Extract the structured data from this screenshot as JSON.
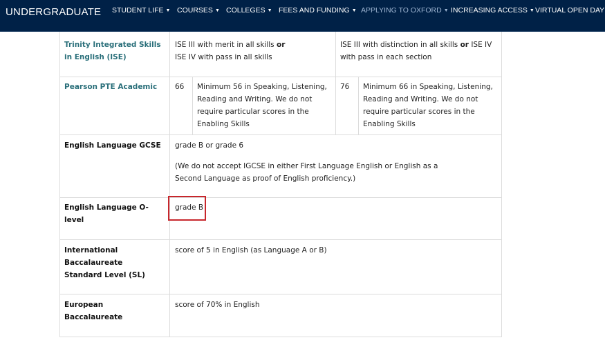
{
  "nav": {
    "brand": "UNDERGRADUATE",
    "items": [
      {
        "label": "STUDENT LIFE",
        "caret": "▼"
      },
      {
        "label": "COURSES",
        "caret": "▼"
      },
      {
        "label": "COLLEGES",
        "caret": "▼"
      },
      {
        "label": "FEES AND FUNDING",
        "caret": "▼"
      },
      {
        "label": "APPLYING TO OXFORD",
        "caret": "▼",
        "active": true
      },
      {
        "label": "INCREASING ACCESS",
        "caret": "▼"
      },
      {
        "label": "VIRTUAL OPEN DAY"
      }
    ]
  },
  "table": {
    "rows": [
      {
        "label_line1": "Trinity Integrated Skills",
        "label_line2": "in English (ISE)",
        "col1_line1_prefix": "ISE III with merit in all skills ",
        "col1_line1_bold": "or",
        "col1_line2": "ISE IV with pass in all skills",
        "col2_line1_prefix": "ISE III with distinction in all skills ",
        "col2_line1_bold": "or",
        "col2_line1_suffix": " ISE IV",
        "col2_line2": "with pass in each section"
      },
      {
        "label": "Pearson PTE Academic",
        "score1": "66",
        "desc1_line1": "Minimum 56 in Speaking, Listening,",
        "desc1_line2": "Reading and Writing. We do not",
        "desc1_line3": "require particular scores in the",
        "desc1_line4": "Enabling Skills",
        "score2": "76",
        "desc2_line1": "Minimum 66 in Speaking, Listening,",
        "desc2_line2": "Reading and Writing. We do not",
        "desc2_line3": "require particular scores in the",
        "desc2_line4": "Enabling Skills"
      },
      {
        "label": "English Language GCSE",
        "value": "grade B or grade 6",
        "note_line1": "(We do not accept IGCSE in either First Language English or English as a",
        "note_line2": "Second Language as proof of English proficiency.)"
      },
      {
        "label_line1": "English Language O-",
        "label_line2": "level",
        "value": "grade B"
      },
      {
        "label_line1": "International",
        "label_line2": "Baccalaureate",
        "label_line3": "Standard Level (SL)",
        "value": "score of 5 in English (as Language A or B)"
      },
      {
        "label_line1": "European",
        "label_line2": "Baccalaureate",
        "value": "score of 70% in English"
      }
    ]
  }
}
